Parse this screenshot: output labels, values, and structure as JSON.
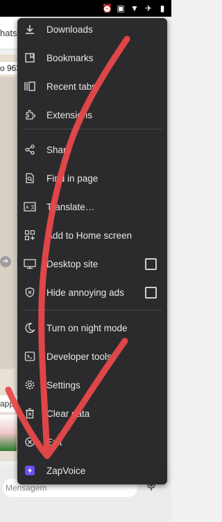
{
  "background": {
    "tab_text": "hats",
    "number_text": "o 963",
    "apps_text": "app",
    "message_placeholder": "Mensagem"
  },
  "menu": {
    "items": [
      {
        "label": "Downloads",
        "icon": "download-icon"
      },
      {
        "label": "Bookmarks",
        "icon": "bookmark-icon"
      },
      {
        "label": "Recent tabs",
        "icon": "recent-tabs-icon"
      },
      {
        "label": "Extensions",
        "icon": "puzzle-icon"
      },
      {
        "label": "Share",
        "icon": "share-icon"
      },
      {
        "label": "Find in page",
        "icon": "find-in-page-icon"
      },
      {
        "label": "Translate…",
        "icon": "translate-icon"
      },
      {
        "label": "Add to Home screen",
        "icon": "add-home-icon"
      },
      {
        "label": "Desktop site",
        "icon": "desktop-icon",
        "checkbox": false
      },
      {
        "label": "Hide annoying ads",
        "icon": "shield-icon",
        "checkbox": false
      },
      {
        "label": "Turn on night mode",
        "icon": "moon-icon"
      },
      {
        "label": "Developer tools",
        "icon": "terminal-icon"
      },
      {
        "label": "Settings",
        "icon": "gear-icon"
      },
      {
        "label": "Clear data",
        "icon": "trash-icon"
      },
      {
        "label": "Exit",
        "icon": "exit-icon"
      },
      {
        "label": "ZapVoice",
        "icon": "zapvoice-icon"
      }
    ]
  },
  "colors": {
    "menu_background": "#2b2b2d",
    "scribble": "#e8484a",
    "zapvoice_accent": "#6c4df0"
  }
}
